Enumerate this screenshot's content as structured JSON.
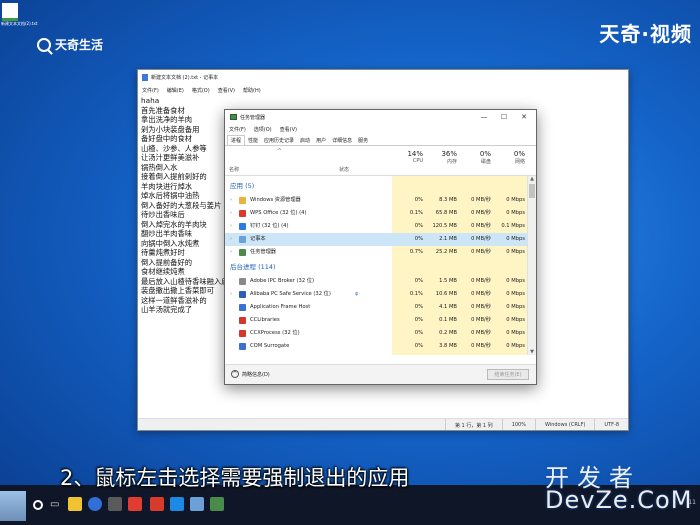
{
  "desktop": {
    "icon_label": "新建文本文档(2).txt",
    "brand": "天奇生活",
    "top_right": "天奇·视频"
  },
  "notepad": {
    "title": "新建文本文档 (2).txt - 记事本",
    "menu": [
      "文件(F)",
      "编辑(E)",
      "格式(O)",
      "查看(V)",
      "帮助(H)"
    ],
    "lines": [
      "haha",
      "首先准备食材",
      "拿出洗净的羊肉",
      "剁为小块装盘备用",
      "备好盘中的食材",
      "山楂、沙参、人参等",
      "让汤汁更鲜美滋补",
      "锅热倒入水",
      "接着倒入提前剁好的",
      "羊肉块进行焯水",
      "焯水后将锅中油热",
      "倒入备好的大葱段与姜片",
      "待炒出香味后",
      "倒入焯完水的羊肉块",
      "翻炒出羊肉香味",
      "向锅中倒入水炖煮",
      "待羹炖煮好时",
      "倒入提前备好的",
      "食材继续炖煮",
      "最后放入山楂待香味融入后",
      "装盘撒出撒上香菜即可",
      "这样一道鲜香滋补的",
      "山羊汤就完成了"
    ],
    "status": {
      "position": "第 1 行，第 1 列",
      "zoom": "100%",
      "line_ending": "Windows (CRLF)",
      "encoding": "UTF-8"
    }
  },
  "task_manager": {
    "title": "任务管理器",
    "menu": [
      "文件(F)",
      "选项(O)",
      "查看(V)"
    ],
    "tabs": [
      "进程",
      "性能",
      "应用历史记录",
      "启动",
      "用户",
      "详细信息",
      "服务"
    ],
    "active_tab": 0,
    "columns": {
      "name": "名称",
      "status": "状态",
      "cpu": {
        "pct": "14%",
        "label": "CPU"
      },
      "memory": {
        "pct": "36%",
        "label": "内存"
      },
      "disk": {
        "pct": "0%",
        "label": "磁盘"
      },
      "network": {
        "pct": "0%",
        "label": "网络"
      }
    },
    "groups": {
      "apps": "应用 (5)",
      "background": "后台进程 (114)"
    },
    "apps": [
      {
        "name": "Windows 资源管理器",
        "cpu": "0%",
        "mem": "8.3 MB",
        "disk": "0 MB/秒",
        "net": "0 Mbps",
        "icon_color": "#e8b43a",
        "expand": true
      },
      {
        "name": "WPS Office (32 位) (4)",
        "cpu": "0.1%",
        "mem": "65.8 MB",
        "disk": "0 MB/秒",
        "net": "0 Mbps",
        "icon_color": "#d83b2c",
        "expand": true
      },
      {
        "name": "钉钉 (32 位) (4)",
        "cpu": "0%",
        "mem": "120.5 MB",
        "disk": "0 MB/秒",
        "net": "0.1 Mbps",
        "icon_color": "#2d7be0",
        "expand": true
      },
      {
        "name": "记事本",
        "cpu": "0%",
        "mem": "2.1 MB",
        "disk": "0 MB/秒",
        "net": "0 Mbps",
        "icon_color": "#6ca0d8",
        "expand": true,
        "selected": true
      },
      {
        "name": "任务管理器",
        "cpu": "0.7%",
        "mem": "25.2 MB",
        "disk": "0 MB/秒",
        "net": "0 Mbps",
        "icon_color": "#4a8a4a",
        "expand": true
      }
    ],
    "background": [
      {
        "name": "Adobe IPC Broker (32 位)",
        "cpu": "0%",
        "mem": "1.5 MB",
        "disk": "0 MB/秒",
        "net": "0 Mbps",
        "icon_color": "#8a8a8a",
        "expand": false
      },
      {
        "name": "Alibaba PC Safe Service (32 位)",
        "cpu": "0.1%",
        "mem": "10.6 MB",
        "disk": "0 MB/秒",
        "net": "0 Mbps",
        "icon_color": "#2b5fb5",
        "expand": true,
        "paused": "φ"
      },
      {
        "name": "Application Frame Host",
        "cpu": "0%",
        "mem": "4.1 MB",
        "disk": "0 MB/秒",
        "net": "0 Mbps",
        "icon_color": "#3b6fd6",
        "expand": false
      },
      {
        "name": "CCLibraries",
        "cpu": "0%",
        "mem": "0.1 MB",
        "disk": "0 MB/秒",
        "net": "0 Mbps",
        "icon_color": "#d6342c",
        "expand": false
      },
      {
        "name": "CCXProcess (32 位)",
        "cpu": "0%",
        "mem": "0.2 MB",
        "disk": "0 MB/秒",
        "net": "0 Mbps",
        "icon_color": "#d6342c",
        "expand": false
      },
      {
        "name": "COM Surrogate",
        "cpu": "0%",
        "mem": "3.8 MB",
        "disk": "0 MB/秒",
        "net": "0 Mbps",
        "icon_color": "#3b6fd6",
        "expand": false
      }
    ],
    "fewer_details": "简略信息(D)",
    "end_task": "结束任务(E)"
  },
  "taskbar": {
    "tray_time": "11"
  },
  "subtitle": "2、鼠标左击选择需要强制退出的应用",
  "watermark": {
    "line1": "开发者",
    "line2": "DevZe.CoM"
  }
}
